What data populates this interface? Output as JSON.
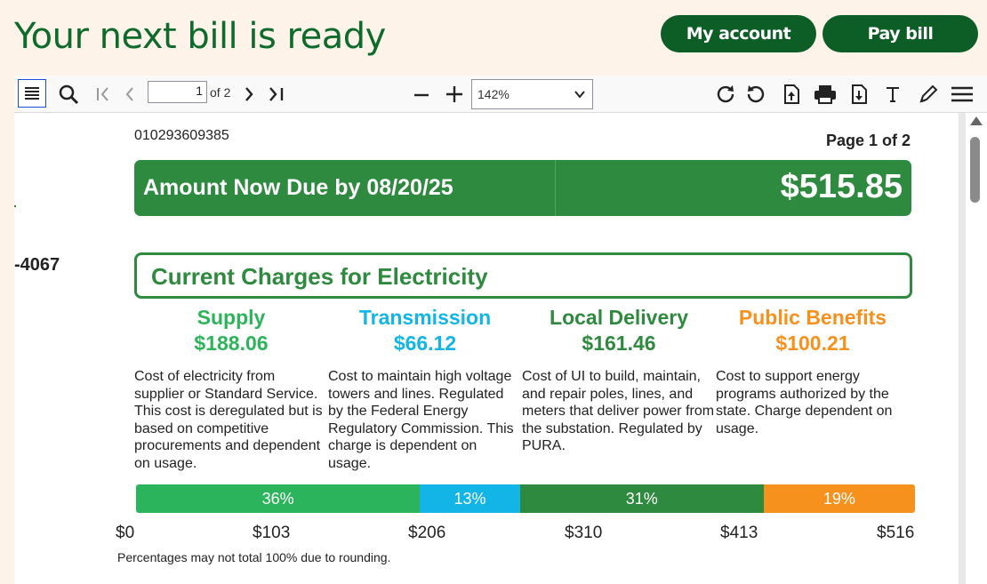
{
  "header": {
    "title": "Your next bill is ready",
    "account_button": "My account",
    "pay_button": "Pay bill"
  },
  "toolbar": {
    "page_value": "1",
    "page_of": "of 2",
    "zoom": "142%",
    "icons": [
      "sidebar-toggle-icon",
      "search-icon",
      "first-page-icon",
      "previous-page-icon",
      "next-page-icon",
      "last-page-icon",
      "zoom-out-icon",
      "zoom-in-icon",
      "rotate-clockwise-icon",
      "rotate-counterclockwise-icon",
      "open-file-icon",
      "print-icon",
      "download-icon",
      "text-tool-icon",
      "draw-tool-icon",
      "menu-icon"
    ]
  },
  "document": {
    "account_number": "010293609385",
    "page_label": "Page 1 of 2",
    "side_fragment": "-4067",
    "due_label": "Amount Now Due by 08/20/25",
    "due_amount": "$515.85",
    "charges_title": "Current Charges for Electricity",
    "categories": [
      {
        "name": "Supply",
        "amount": "$188.06",
        "color": "#2db45a",
        "desc": "Cost of electricity from supplier or Standard Service. This cost is deregulated but is based on competitive procurements and dependent on usage."
      },
      {
        "name": "Transmission",
        "amount": "$66.12",
        "color": "#12b5e6",
        "desc": "Cost to maintain high voltage towers and lines. Regulated by the Federal Energy Regulatory Commission. This charge is dependent on usage."
      },
      {
        "name": "Local Delivery",
        "amount": "$161.46",
        "color": "#2e8a3e",
        "desc": "Cost of UI to build, maintain, and repair poles, lines, and meters that deliver power from the substation. Regulated by PURA."
      },
      {
        "name": "Public Benefits",
        "amount": "$100.21",
        "color": "#f7911e",
        "desc": "Cost to support energy programs authorized by the state. Charge dependent on usage."
      }
    ],
    "bar_segments": [
      {
        "label": "36%",
        "value": 188.06,
        "color": "#2bb45b"
      },
      {
        "label": "13%",
        "value": 66.12,
        "color": "#12b5e6"
      },
      {
        "label": "31%",
        "value": 161.46,
        "color": "#2e8a3e"
      },
      {
        "label": "19%",
        "value": 100.21,
        "color": "#f7911e"
      }
    ],
    "scale_ticks": [
      "$0",
      "$103",
      "$206",
      "$310",
      "$413",
      "$516"
    ],
    "rounding_note": "Percentages may not total 100% due to rounding."
  }
}
